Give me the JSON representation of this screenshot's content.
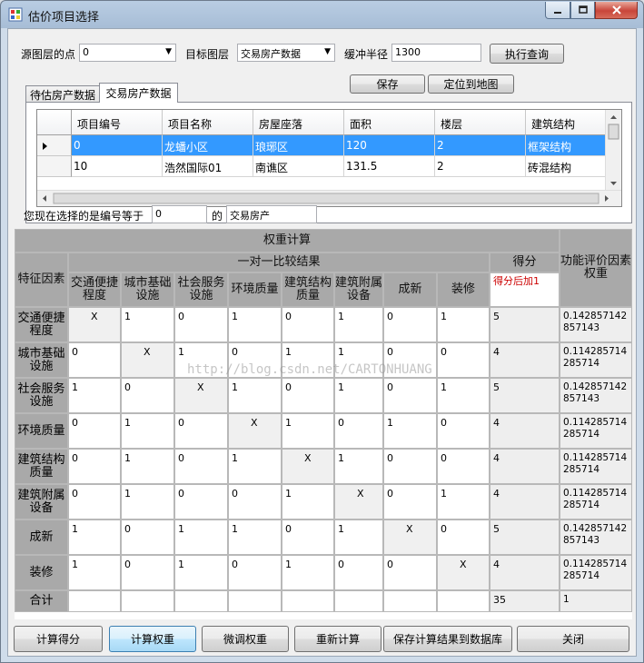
{
  "window": {
    "title": "估价项目选择"
  },
  "query": {
    "source_label": "源图层的点",
    "source_value": "0",
    "target_label": "目标图层",
    "target_value": "交易房产数据",
    "radius_label": "缓冲半径",
    "radius_value": "1300",
    "execute_label": "执行查询"
  },
  "toolbar": {
    "save_label": "保存",
    "locate_label": "定位到地图"
  },
  "tabs": [
    {
      "label": "待估房产数据"
    },
    {
      "label": "交易房产数据"
    }
  ],
  "property_grid": {
    "columns": [
      "项目编号",
      "项目名称",
      "房屋座落",
      "面积",
      "楼层",
      "建筑结构"
    ],
    "rows": [
      [
        "0",
        "龙蟠小区",
        "琅琊区",
        "120",
        "2",
        "框架结构"
      ],
      [
        "10",
        "浩然国际01",
        "南谯区",
        "131.5",
        "2",
        "砖混结构"
      ]
    ]
  },
  "selection": {
    "prefix": "您现在选择的是编号等于",
    "id_value": "0",
    "mid": "的",
    "layer_value": "交易房产"
  },
  "weight_grid": {
    "title": "权重计算",
    "compare_title": "一对一比较结果",
    "factor_header": "特征因素",
    "score_header": "得分",
    "weight_header": "功能评价因素权重",
    "score_note": "得分后加1",
    "columns": [
      "交通便捷程度",
      "城市基础设施",
      "社会服务设施",
      "环境质量",
      "建筑结构质量",
      "建筑附属设备",
      "成新",
      "装修"
    ],
    "rows": [
      {
        "name": "交通便捷程度",
        "values": [
          "X",
          "1",
          "0",
          "1",
          "0",
          "1",
          "0",
          "1"
        ],
        "score": "5",
        "weight": "0.142857142857143"
      },
      {
        "name": "城市基础设施",
        "values": [
          "0",
          "X",
          "1",
          "0",
          "1",
          "1",
          "0",
          "0"
        ],
        "score": "4",
        "weight": "0.114285714285714"
      },
      {
        "name": "社会服务设施",
        "values": [
          "1",
          "0",
          "X",
          "1",
          "0",
          "1",
          "0",
          "1"
        ],
        "score": "5",
        "weight": "0.142857142857143"
      },
      {
        "name": "环境质量",
        "values": [
          "0",
          "1",
          "0",
          "X",
          "1",
          "0",
          "1",
          "0"
        ],
        "score": "4",
        "weight": "0.114285714285714"
      },
      {
        "name": "建筑结构质量",
        "values": [
          "0",
          "1",
          "0",
          "1",
          "X",
          "1",
          "0",
          "0"
        ],
        "score": "4",
        "weight": "0.114285714285714"
      },
      {
        "name": "建筑附属设备",
        "values": [
          "0",
          "1",
          "0",
          "0",
          "1",
          "X",
          "0",
          "1"
        ],
        "score": "4",
        "weight": "0.114285714285714"
      },
      {
        "name": "成新",
        "values": [
          "1",
          "0",
          "1",
          "1",
          "0",
          "1",
          "X",
          "0"
        ],
        "score": "5",
        "weight": "0.142857142857143"
      },
      {
        "name": "装修",
        "values": [
          "1",
          "0",
          "1",
          "0",
          "1",
          "0",
          "0",
          "X"
        ],
        "score": "4",
        "weight": "0.114285714285714"
      }
    ],
    "total": {
      "name": "合计",
      "score": "35",
      "weight": "1"
    }
  },
  "watermark": "http://blog.csdn.net/CARTONHUANG",
  "buttons": {
    "calc_score": "计算得分",
    "calc_weight": "计算权重",
    "adjust_weight": "微调权重",
    "recalc": "重新计算",
    "save_db": "保存计算结果到数据库",
    "close": "关闭"
  },
  "colors": {
    "selection": "#3399ff",
    "header_gray": "#a9a9a9",
    "note_red": "#cc0000"
  }
}
